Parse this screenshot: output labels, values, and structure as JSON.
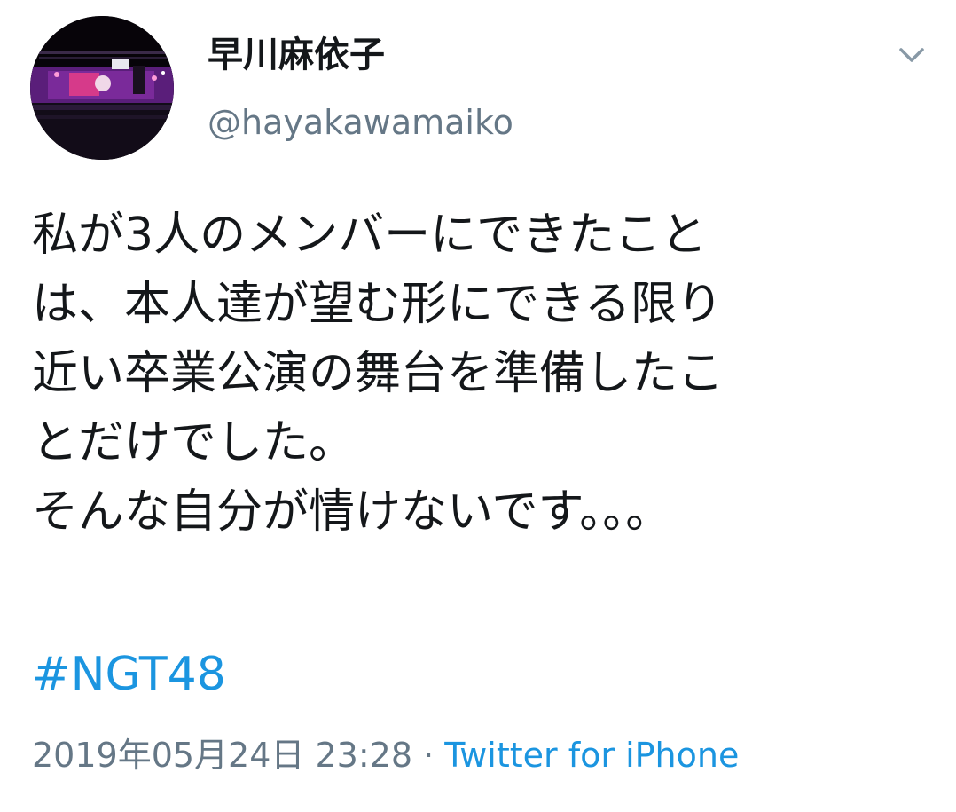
{
  "user": {
    "display_name": "早川麻依子",
    "handle": "@hayakawamaiko",
    "avatar_icon": "stage-photo-avatar"
  },
  "menu": {
    "icon": "chevron-down-icon"
  },
  "tweet": {
    "lines": [
      "私が3人のメンバーにできたこと",
      "は、本人達が望む形にできる限り",
      "近い卒業公演の舞台を準備したこ",
      "とだけでした。",
      "そんな自分が情けないです。。。"
    ],
    "hashtag": "#NGT48"
  },
  "meta": {
    "timestamp": "2019年05月24日 23:28",
    "separator": "·",
    "source": "Twitter for iPhone"
  },
  "colors": {
    "link": "#1b95e0",
    "secondary_text": "#657786",
    "primary_text": "#14171a"
  }
}
